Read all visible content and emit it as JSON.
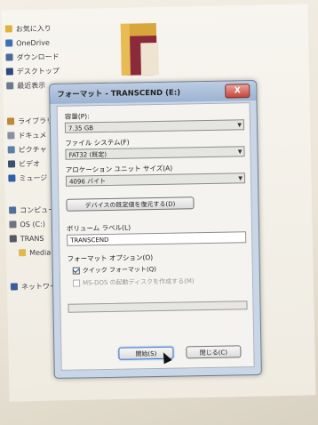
{
  "explorer": {
    "nav_items": [
      {
        "label": "お気に入り",
        "icon": "star-icon"
      },
      {
        "label": "OneDrive",
        "icon": "cloud-icon"
      },
      {
        "label": "ダウンロード",
        "icon": "download-icon"
      },
      {
        "label": "デスクトップ",
        "icon": "desktop-icon"
      },
      {
        "label": "最近表示",
        "icon": "recent-icon"
      },
      {
        "label": "ライブラリ",
        "icon": "library-icon"
      },
      {
        "label": "ドキュメ",
        "icon": "document-icon"
      },
      {
        "label": "ピクチャ",
        "icon": "picture-icon"
      },
      {
        "label": "ビデオ",
        "icon": "video-icon"
      },
      {
        "label": "ミュージ",
        "icon": "music-icon"
      },
      {
        "label": "コンピュー",
        "icon": "computer-icon"
      },
      {
        "label": "OS (C:)",
        "icon": "drive-icon"
      },
      {
        "label": "TRANS",
        "icon": "usb-drive-icon"
      },
      {
        "label": "Media",
        "icon": "folder-icon"
      },
      {
        "label": "ネットワー",
        "icon": "network-icon"
      }
    ]
  },
  "dialog": {
    "title": "フォーマット - TRANSCEND (E:)",
    "close_label": "X",
    "capacity": {
      "label": "容量(P):",
      "value": "7.35 GB"
    },
    "filesystem": {
      "label": "ファイル システム(F)",
      "value": "FAT32 (既定)"
    },
    "allocation": {
      "label": "アロケーション ユニット サイズ(A)",
      "value": "4096 バイト"
    },
    "restore_defaults_label": "デバイスの既定値を復元する(D)",
    "volume": {
      "label": "ボリューム ラベル(L)",
      "value": "TRANSCEND"
    },
    "format_options": {
      "label": "フォーマット オプション(O)",
      "quick_format": {
        "label": "クイック フォーマット(Q)",
        "checked": true
      },
      "msdos_disk": {
        "label": "MS-DOS の起動ディスクを作成する(M)",
        "checked": false,
        "disabled": true
      }
    },
    "progress": 0,
    "start_label": "開始(S)",
    "close_button_label": "閉じる(C)"
  },
  "colors": {
    "dialog_frame": "#c9d6e6",
    "close_red": "#c4453a"
  }
}
